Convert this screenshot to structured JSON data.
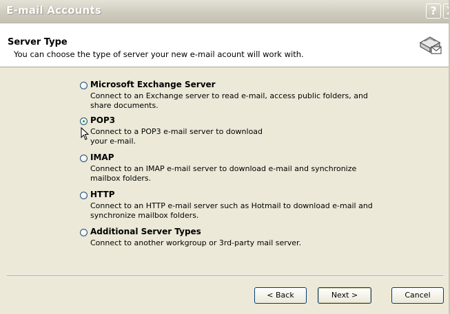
{
  "window": {
    "title": "E-mail Accounts",
    "help_glyph": "?",
    "close_glyph": "X"
  },
  "header": {
    "title": "Server Type",
    "subtitle": "You can choose the type of server your new e-mail acount will work with."
  },
  "options": [
    {
      "label": "Microsoft Exchange Server",
      "description": "Connect to an Exchange server to read e-mail, access public folders, and share documents.",
      "selected": false
    },
    {
      "label": "POP3",
      "description": "Connect to a POP3 e-mail server to download your e-mail.",
      "selected": true
    },
    {
      "label": "IMAP",
      "description": "Connect to an IMAP e-mail server to download e-mail and synchronize mailbox folders.",
      "selected": false
    },
    {
      "label": "HTTP",
      "description": "Connect to an HTTP e-mail server such as Hotmail to download e-mail and synchronize mailbox folders.",
      "selected": false
    },
    {
      "label": "Additional Server Types",
      "description": "Connect to another workgroup or 3rd-party mail server.",
      "selected": false
    }
  ],
  "buttons": {
    "back": "< Back",
    "next": "Next >",
    "cancel": "Cancel"
  },
  "colors": {
    "title_text": "#ffffff",
    "header_bg": "#ffffff",
    "dialog_bg": "#ece9d8",
    "radio_dot": "#21a121"
  }
}
